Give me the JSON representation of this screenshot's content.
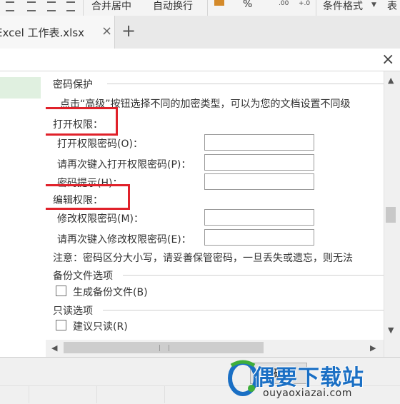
{
  "ribbon": {
    "merge_center": "合并居中",
    "wrap_text": "自动换行",
    "percent": "%",
    "conditional_format": "条件格式",
    "table_partial": "表"
  },
  "tabs": {
    "document_title": "Excel 工作表.xlsx",
    "close_symbol": "×",
    "new_tab_symbol": "+"
  },
  "dialog": {
    "close_symbol": "×",
    "section_password": "密码保护",
    "description": "点击“高级”按钮选择不同的加密类型，可以为您的文档设置不同级",
    "open_permission": {
      "heading": "打开权限：",
      "password_label": "打开权限密码(O)：",
      "password_value": "",
      "confirm_label": "请再次键入打开权限密码(P)：",
      "confirm_value": "",
      "hint_label": "密码提示(H)：",
      "hint_value": ""
    },
    "edit_permission": {
      "heading": "编辑权限：",
      "password_label": "修改权限密码(M)：",
      "password_value": "",
      "confirm_label": "请再次键入修改权限密码(E)：",
      "confirm_value": ""
    },
    "note": "注意：密码区分大小写，请妥善保管密码，一旦丢失或遗忘，则无法",
    "backup": {
      "heading": "备份文件选项",
      "checkbox_label": "生成备份文件(B)",
      "checked": false
    },
    "readonly": {
      "heading": "只读选项",
      "checkbox_label": "建议只读(R)",
      "checked": false
    },
    "ok_label": "确"
  },
  "colors": {
    "highlight": "#e0212a",
    "selected_nav": "#e0f0e0",
    "watermark": "#1a6fc4"
  },
  "watermark": {
    "name": "偶要下载站",
    "url": "ouyaoxiazai.com"
  }
}
